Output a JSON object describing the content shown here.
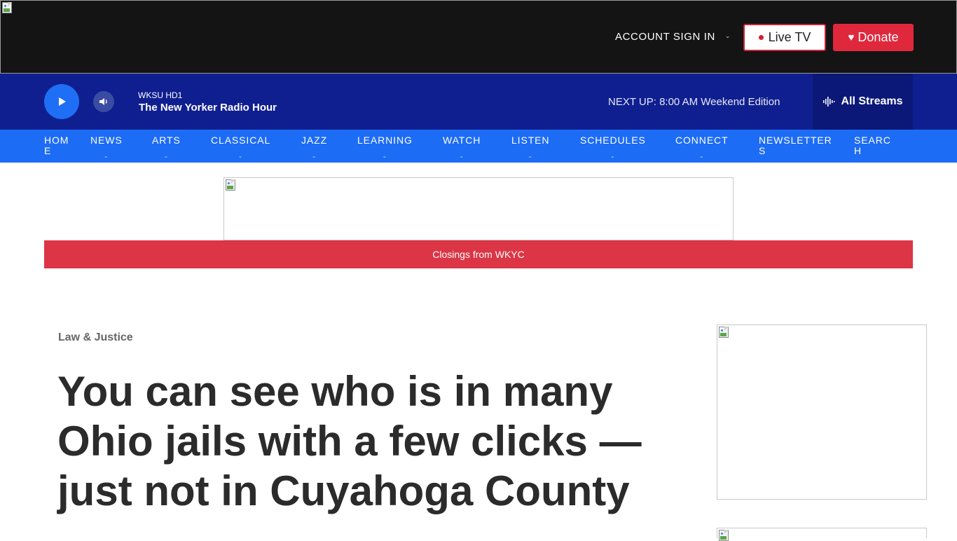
{
  "header": {
    "account_label": "ACCOUNT SIGN IN",
    "live_tv_label": "Live TV",
    "donate_label": "Donate",
    "colors": {
      "background": "#141414",
      "donate": "#e0283d",
      "live_dot": "#d41f2e"
    }
  },
  "player": {
    "station": "WKSU HD1",
    "program": "The New Yorker Radio Hour",
    "next_up_label": "NEXT UP:",
    "next_up_time": "8:00 AM",
    "next_up_show": "Weekend Edition",
    "streams_label": "All Streams",
    "colors": {
      "bar": "#101f8f",
      "play": "#1e6ff5"
    }
  },
  "nav": {
    "items": [
      {
        "label": "HOME",
        "has_dropdown": false
      },
      {
        "label": "NEWS",
        "has_dropdown": true
      },
      {
        "label": "ARTS",
        "has_dropdown": true
      },
      {
        "label": "CLASSICAL",
        "has_dropdown": true
      },
      {
        "label": "JAZZ",
        "has_dropdown": true
      },
      {
        "label": "LEARNING",
        "has_dropdown": true
      },
      {
        "label": "WATCH",
        "has_dropdown": true
      },
      {
        "label": "LISTEN",
        "has_dropdown": true
      },
      {
        "label": "SCHEDULES",
        "has_dropdown": true
      },
      {
        "label": "CONNECT",
        "has_dropdown": true
      },
      {
        "label": "NEWSLETTERS",
        "has_dropdown": false
      },
      {
        "label": "SEARCH",
        "has_dropdown": false
      }
    ],
    "colors": {
      "background": "#1d6cf5"
    }
  },
  "alert": {
    "closings_label": "Closings from WKYC",
    "color": "#dc3545"
  },
  "article": {
    "category": "Law & Justice",
    "headline": "You can see who is in many Ohio jails with a few clicks — just not in Cuyahoga County"
  }
}
